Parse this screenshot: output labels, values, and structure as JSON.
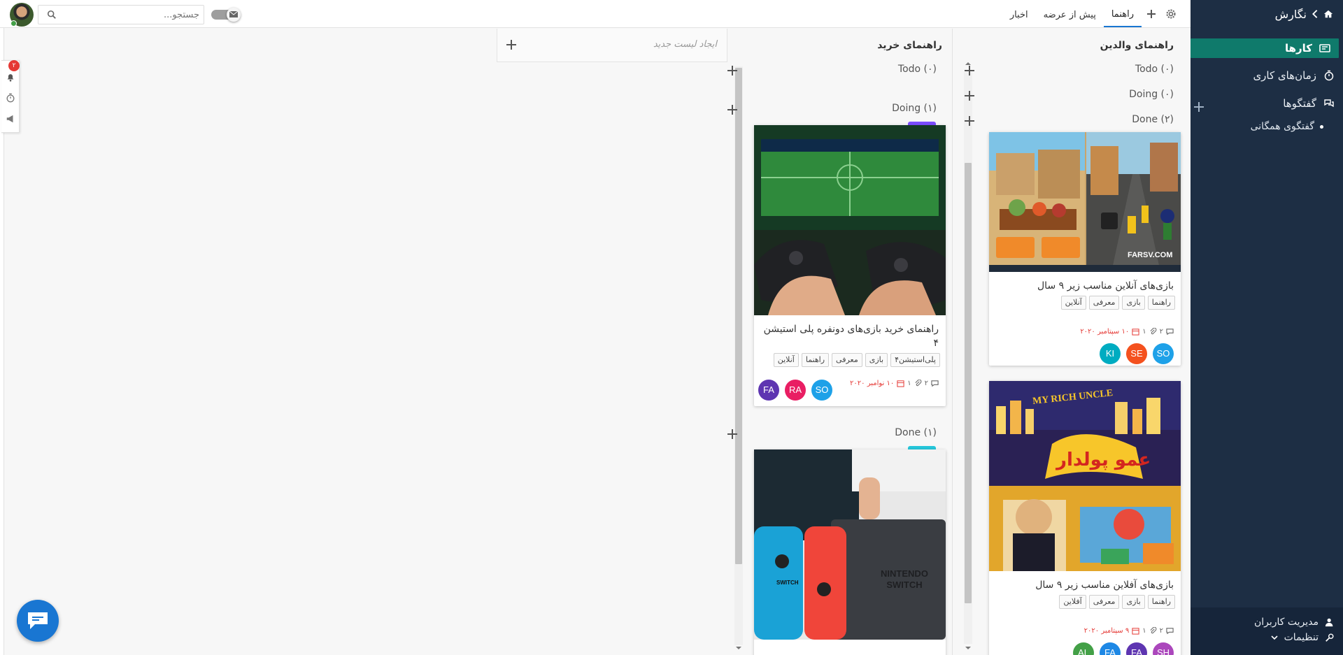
{
  "sidebar": {
    "brand": "نگارش",
    "items": [
      {
        "label": "کارها",
        "icon": "cards-icon",
        "active": true
      },
      {
        "label": "زمان‌های کاری",
        "icon": "stopwatch-icon",
        "active": false
      },
      {
        "label": "گفتگوها",
        "icon": "chat-bubbles-icon",
        "active": false
      }
    ],
    "sub_items": [
      "گفتگوی همگانی"
    ],
    "footer": {
      "user_management": "مدیریت کاربران",
      "settings": "تنظیمات"
    }
  },
  "topbar": {
    "tabs": [
      {
        "label": "اخبار",
        "active": false
      },
      {
        "label": "پیش از عرضه",
        "active": false
      },
      {
        "label": "راهنما",
        "active": true
      }
    ],
    "search_placeholder": "جستجو..."
  },
  "mini_toolbar": {
    "notification_count": "۲"
  },
  "board": {
    "new_list_placeholder": "ایجاد لیست جدید",
    "lists": [
      {
        "title": "راهنمای والدین",
        "groups": [
          {
            "name": "Todo",
            "count": "(۰)"
          },
          {
            "name": "Doing",
            "count": "(۰)"
          },
          {
            "name": "Done",
            "count": "(۲)"
          }
        ],
        "cards": [
          {
            "title": "بازی‌های آنلاین مناسب زیر ۹ سال",
            "tags": [
              "راهنما",
              "بازی",
              "معرفی",
              "آنلاین"
            ],
            "comments": "۲",
            "attachments": "۱",
            "date": "۱۰ سپتامبر ۲۰۲۰",
            "members": [
              {
                "initials": "SO",
                "color": "#1ea1e8"
              },
              {
                "initials": "SE",
                "color": "#f4511e"
              },
              {
                "initials": "KI",
                "color": "#00acc1"
              }
            ],
            "cover_text": "FARSV.COM"
          },
          {
            "title": "بازی‌های آفلاین مناسب زیر ۹ سال",
            "tags": [
              "راهنما",
              "بازی",
              "معرفی",
              "آفلاین"
            ],
            "comments": "۲",
            "attachments": "۱",
            "date": "۹ سپتامبر ۲۰۲۰",
            "members": [
              {
                "initials": "SH",
                "color": "#ab47bc"
              },
              {
                "initials": "FA",
                "color": "#5e35b1"
              },
              {
                "initials": "FA",
                "color": "#1e88e5"
              },
              {
                "initials": "AL",
                "color": "#43a047"
              }
            ],
            "cover_text": "عمو پولدار",
            "cover_caption": "MY RICH UNCLE",
            "label_color": "#7c4dff"
          }
        ]
      },
      {
        "title": "راهنمای خرید",
        "groups": [
          {
            "name": "Todo",
            "count": "(۰)"
          },
          {
            "name": "Doing",
            "count": "(۱)"
          },
          {
            "name": "Done",
            "count": "(۱)"
          }
        ],
        "cards": [
          {
            "title": "راهنمای خرید بازی‌های دونفره پلی استیشن ۴",
            "tags": [
              "پلی‌استیشن۴",
              "بازی",
              "معرفی",
              "راهنما",
              "آنلاین"
            ],
            "comments": "۲",
            "attachments": "۱",
            "date": "۱۰ نوامبر ۲۰۲۰",
            "members": [
              {
                "initials": "SO",
                "color": "#1ea1e8"
              },
              {
                "initials": "RA",
                "color": "#e91e63"
              },
              {
                "initials": "FA",
                "color": "#5e35b1"
              }
            ],
            "label_color": "#7c4dff"
          },
          {
            "title": "",
            "cover_text": "NINTENDO SWITCH",
            "cover_caption": "SWITCH",
            "label_color": "#26c6da"
          }
        ]
      }
    ]
  },
  "colors": {
    "sidebar": "#1d2e44",
    "active_item": "#0f7a6b",
    "accent": "#1976d2",
    "date": "#e53935"
  }
}
